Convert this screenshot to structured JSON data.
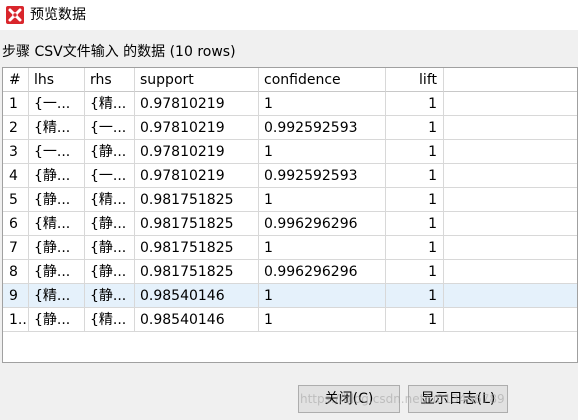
{
  "window": {
    "title": "预览数据",
    "icon": "app-logo-icon"
  },
  "subtitle": "步骤 CSV文件输入 的数据 (10 rows)",
  "table": {
    "columns": [
      "#",
      "lhs",
      "rhs",
      "support",
      "confidence",
      "lift"
    ],
    "rows": [
      [
        "1",
        "{一...",
        "{精...",
        "0.97810219",
        "1",
        "1"
      ],
      [
        "2",
        "{精...",
        "{一...",
        "0.97810219",
        "0.992592593",
        "1"
      ],
      [
        "3",
        "{一...",
        "{静...",
        "0.97810219",
        "1",
        "1"
      ],
      [
        "4",
        "{静...",
        "{一...",
        "0.97810219",
        "0.992592593",
        "1"
      ],
      [
        "5",
        "{静...",
        "{精...",
        "0.981751825",
        "1",
        "1"
      ],
      [
        "6",
        "{精...",
        "{静...",
        "0.981751825",
        "0.996296296",
        "1"
      ],
      [
        "7",
        "{静...",
        "{静...",
        "0.981751825",
        "1",
        "1"
      ],
      [
        "8",
        "{静...",
        "{静...",
        "0.981751825",
        "0.996296296",
        "1"
      ],
      [
        "9",
        "{精...",
        "{静...",
        "0.98540146",
        "1",
        "1"
      ],
      [
        "1...",
        "{静...",
        "{精...",
        "0.98540146",
        "1",
        "1"
      ]
    ],
    "selected_row": 8
  },
  "buttons": {
    "close": "关闭(C)",
    "show_log": "显示日志(L)"
  },
  "watermark": "https://blog.csdn.net/u013456789"
}
